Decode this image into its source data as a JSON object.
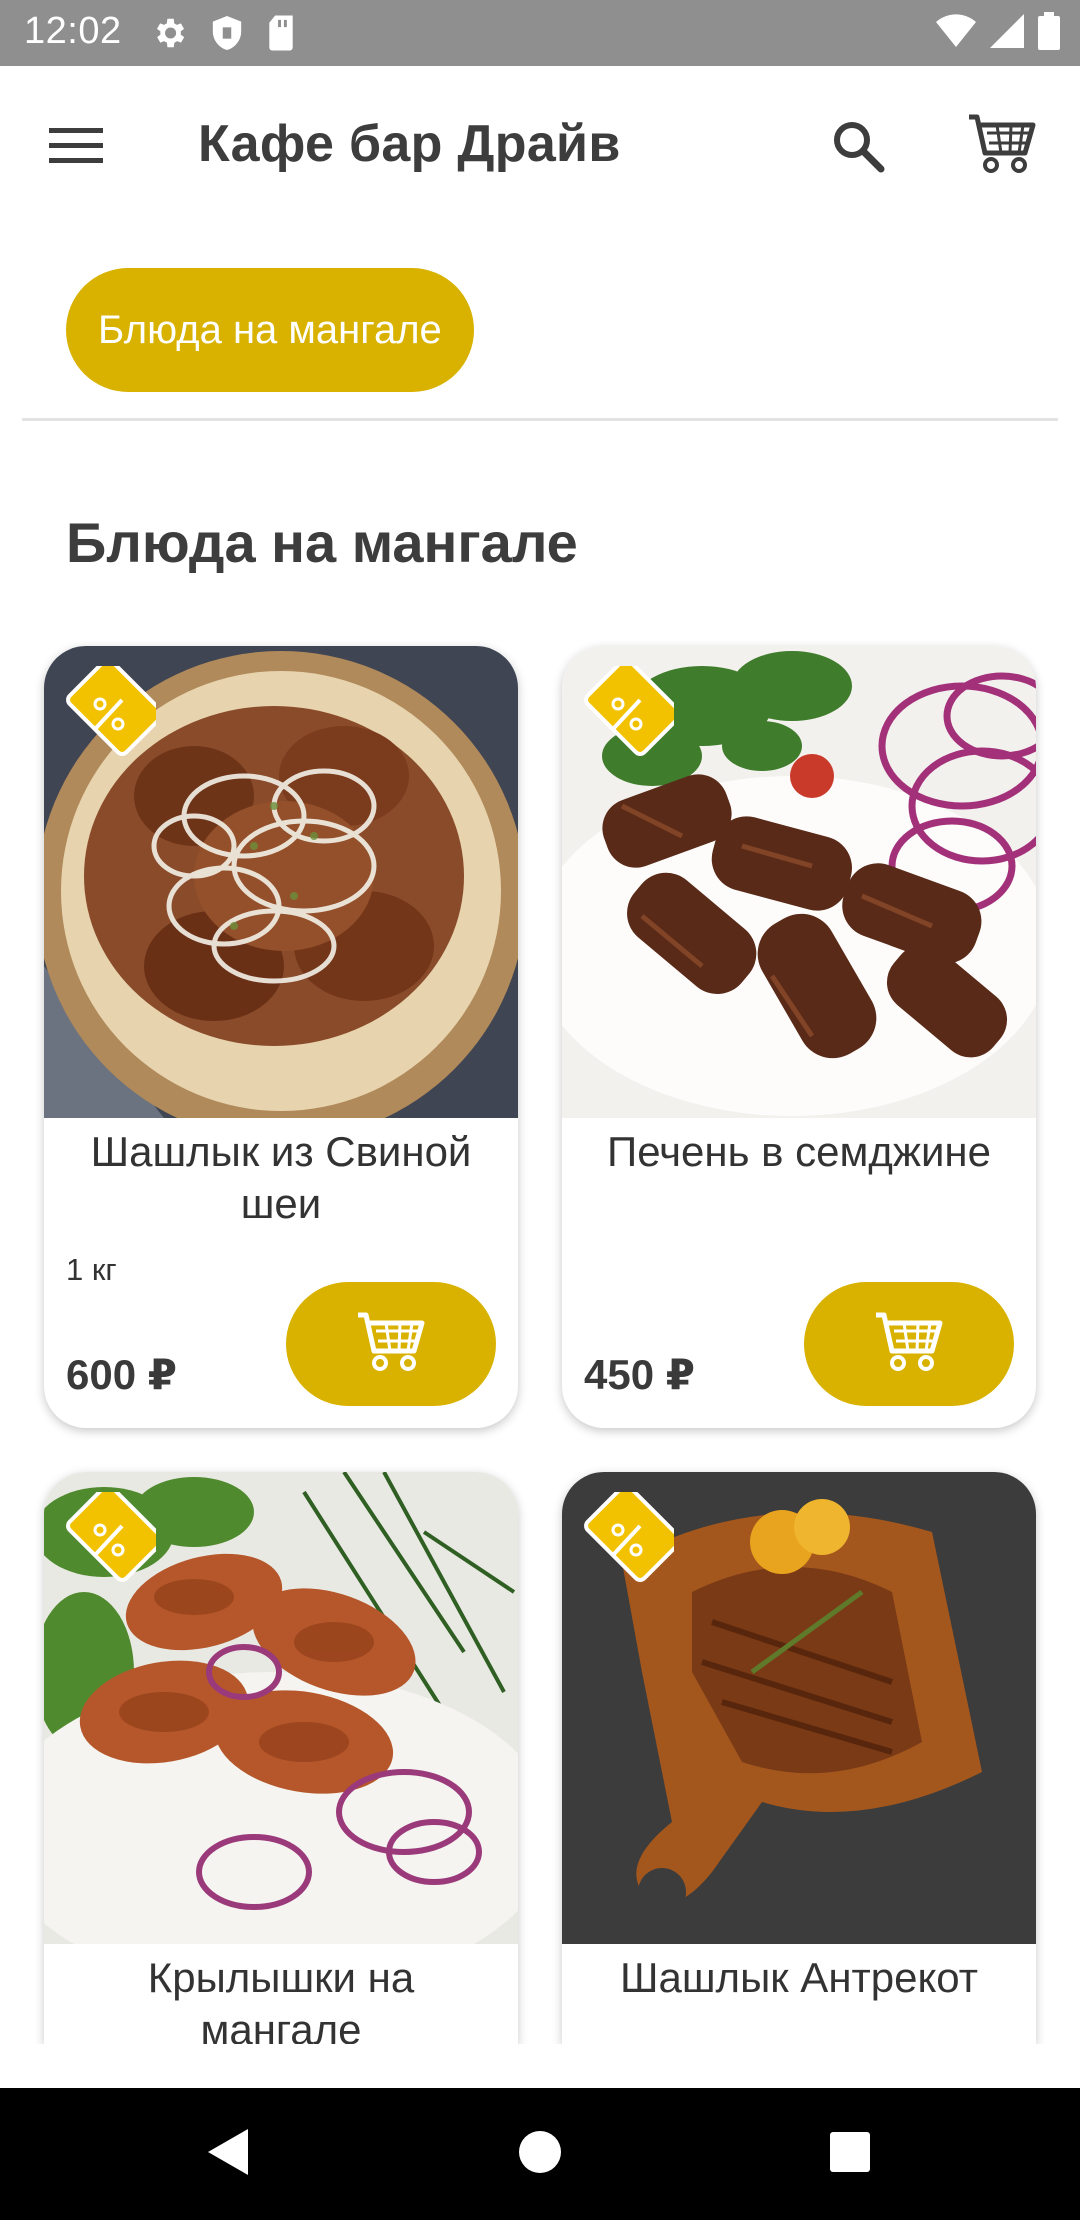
{
  "status_bar": {
    "time": "12:02",
    "left_icons": [
      "gear-icon",
      "shield-icon",
      "sd-card-icon"
    ],
    "right_icons": [
      "wifi-icon",
      "signal-icon",
      "battery-icon"
    ],
    "color": "#8f8f8f"
  },
  "app_bar": {
    "title": "Кафе бар Драйв",
    "menu_icon": "menu-icon",
    "search_icon": "search-icon",
    "cart_icon": "cart-icon"
  },
  "category_chip": {
    "label": "Блюда на мангале",
    "selected": true,
    "color": "#d9b200"
  },
  "section": {
    "title": "Блюда на мангале"
  },
  "products": [
    {
      "name": "Шашлык из Свиной шеи",
      "weight": "1 кг",
      "price": "600 ₽",
      "badge": "discount-tag-icon",
      "image": "grilled pork skewers with onion rings"
    },
    {
      "name": "Печень в семджине",
      "weight": "",
      "price": "450 ₽",
      "badge": "discount-tag-icon",
      "image": "liver wrapped in caul fat with red onion"
    },
    {
      "name": "Крылышки на мангале",
      "weight": "",
      "price": "",
      "badge": "discount-tag-icon",
      "image": "grilled chicken wings with onion and dill"
    },
    {
      "name": "Шашлык Антрекот",
      "weight": "",
      "price": "",
      "badge": "discount-tag-icon",
      "image": "grilled entrecote on wooden board with lemon"
    }
  ],
  "nav_bar": {
    "buttons": [
      "back-icon",
      "home-icon",
      "recents-icon"
    ]
  },
  "colors": {
    "accent": "#d9b200",
    "text": "#333333"
  }
}
